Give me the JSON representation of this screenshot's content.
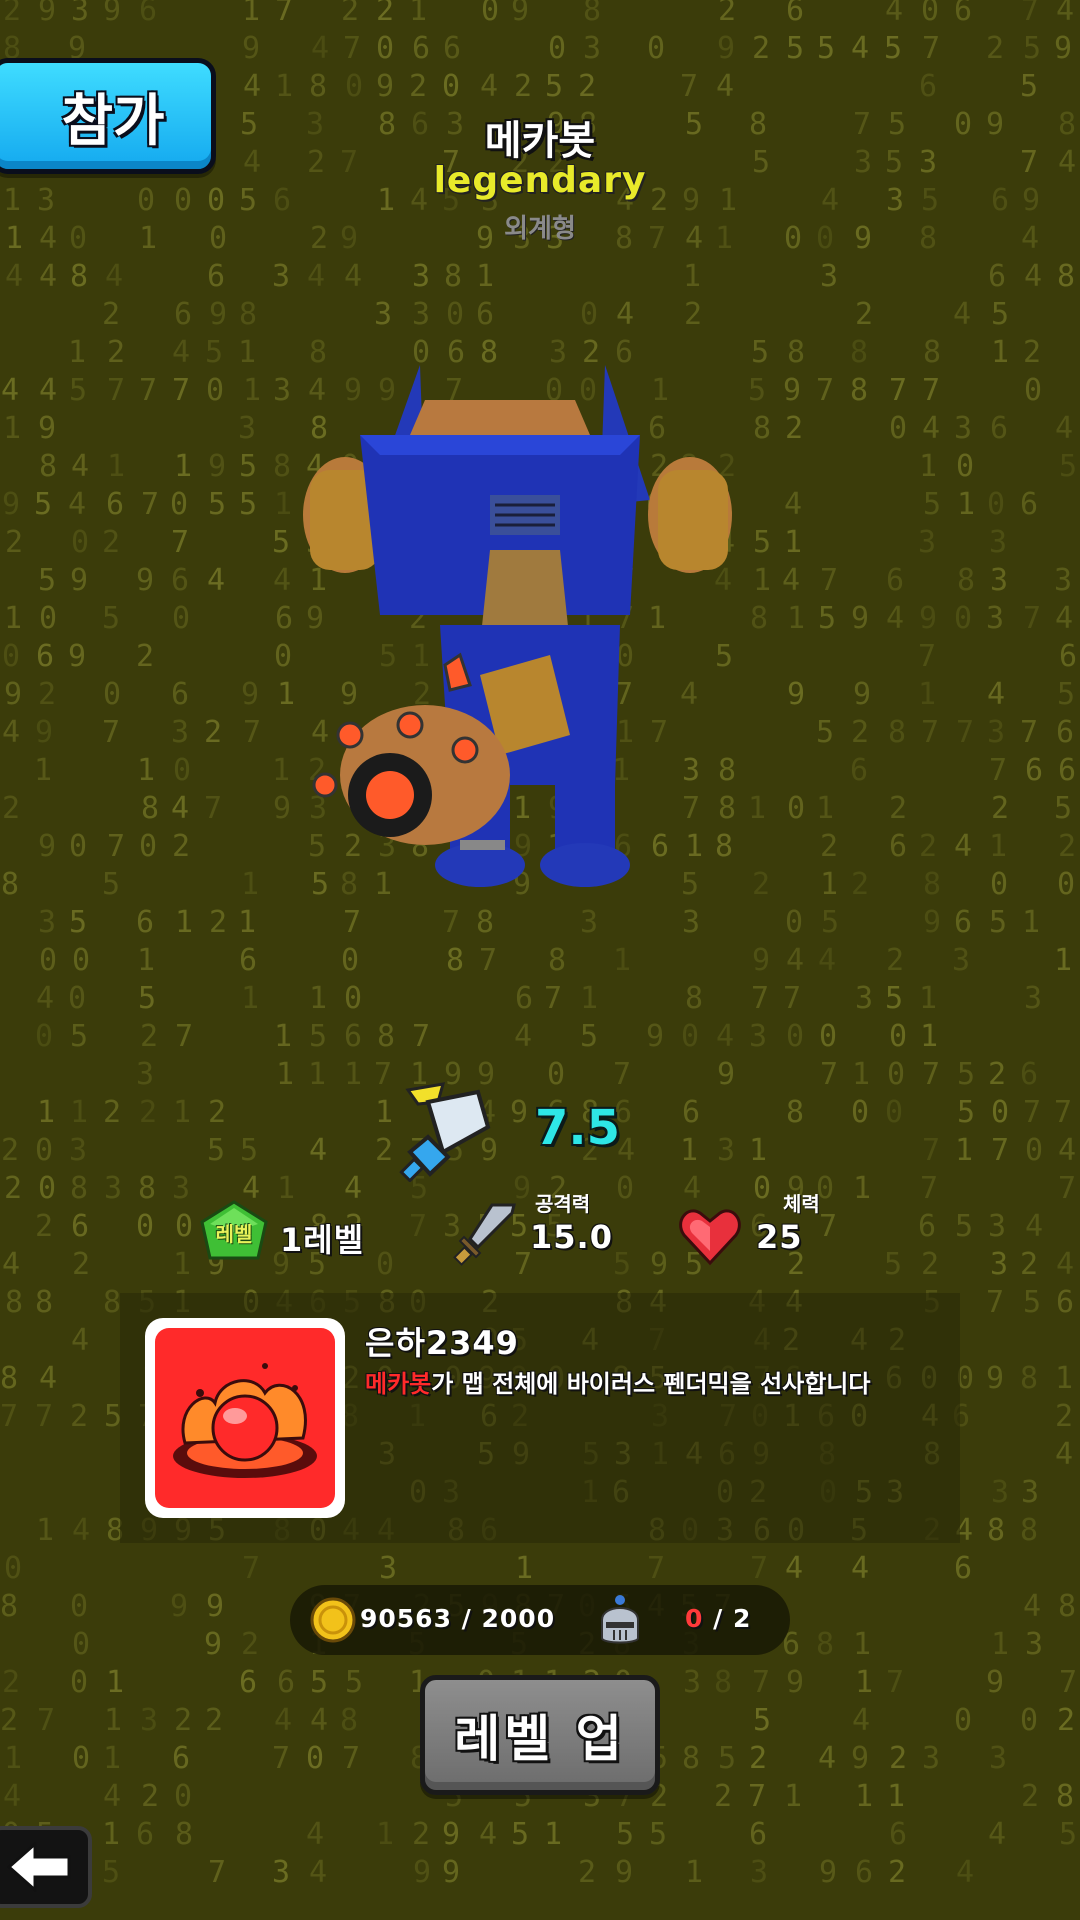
{
  "join_button": {
    "label": "참가"
  },
  "character": {
    "name": "메카봇",
    "rarity": "legendary",
    "type": "외계형",
    "power": "7.5"
  },
  "stats": {
    "level_badge": "레벨",
    "level_value": "1레벨",
    "attack_label": "공격력",
    "attack_value": "15.0",
    "hp_label": "체력",
    "hp_value": "25"
  },
  "chat": {
    "username": "은하2349",
    "message_highlight": "메카봇",
    "message_rest": "가 맵 전체에 바이러스 펜더믹을 선사합니다"
  },
  "resources": {
    "coins": "90563 / 2000",
    "troops_current": "0",
    "troops_total": " / 2"
  },
  "level_up_button": {
    "label": "레벨 업"
  },
  "icons": {
    "power": "sword-power-icon",
    "level": "green-gem-icon",
    "attack": "sword-icon",
    "hp": "heart-icon",
    "coin": "gold-coin-icon",
    "troops": "knight-helmet-icon",
    "back": "back-arrow-icon",
    "skill": "red-virus-orb-icon"
  },
  "colors": {
    "background": "#3b3c0a",
    "digit_rain": "#7b7d2a",
    "join_button": "#1cb5f5",
    "rarity": "#e8ea2a",
    "power": "#2ee6e6",
    "highlight": "#ff2a2a"
  }
}
